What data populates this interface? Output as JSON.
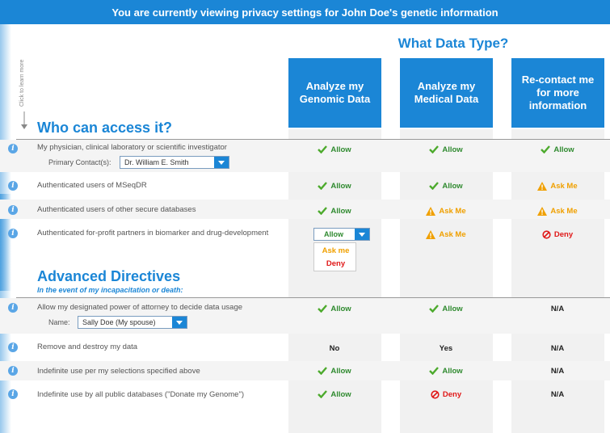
{
  "banner": "You are currently viewing privacy settings for John Doe's genetic information",
  "what_data_type": "What Data Type?",
  "side_hint": "Click to learn more",
  "columns": [
    {
      "label": "Analyze my Genomic Data"
    },
    {
      "label": "Analyze my Medical Data"
    },
    {
      "label": "Re-contact me for more information"
    }
  ],
  "who_title": "Who can access it?",
  "who_rows": [
    {
      "label": "My physician, clinical laboratory or scientific investigator",
      "values": [
        "Allow",
        "Allow",
        "Allow"
      ]
    },
    {
      "label": "Authenticated users of MSeqDR",
      "values": [
        "Allow",
        "Allow",
        "Ask Me"
      ]
    },
    {
      "label": "Authenticated users of other secure databases",
      "values": [
        "Allow",
        "Ask Me",
        "Ask Me"
      ]
    },
    {
      "label": "Authenticated for-profit partners in biomarker and drug-development",
      "values": [
        "Allow",
        "Ask Me",
        "Deny"
      ]
    }
  ],
  "primary_contact": {
    "label": "Primary Contact(s):",
    "value": "Dr. William E. Smith"
  },
  "row4_select": {
    "value": "Allow",
    "options": [
      "Ask me",
      "Deny"
    ]
  },
  "advanced_title": "Advanced Directives",
  "advanced_subtitle": "In the event of my incapacitation or death:",
  "advanced_rows": [
    {
      "label": "Allow my designated power of attorney to decide data usage",
      "values": [
        "Allow",
        "Allow",
        "N/A"
      ]
    },
    {
      "label": "Remove and destroy my data",
      "values": [
        "No",
        "Yes",
        "N/A"
      ]
    },
    {
      "label": "Indefinite use per my selections specified above",
      "values": [
        "Allow",
        "Allow",
        "N/A"
      ]
    },
    {
      "label": "Indefinite use by all public databases (\"Donate my Genome\")",
      "values": [
        "Allow",
        "Deny",
        "N/A"
      ]
    }
  ],
  "name_field": {
    "label": "Name:",
    "value": "Sally Doe (My spouse)"
  },
  "colors": {
    "accent": "#1b86d6",
    "allow": "#2f8a2f",
    "askme": "#f0a000",
    "deny": "#e01818"
  }
}
